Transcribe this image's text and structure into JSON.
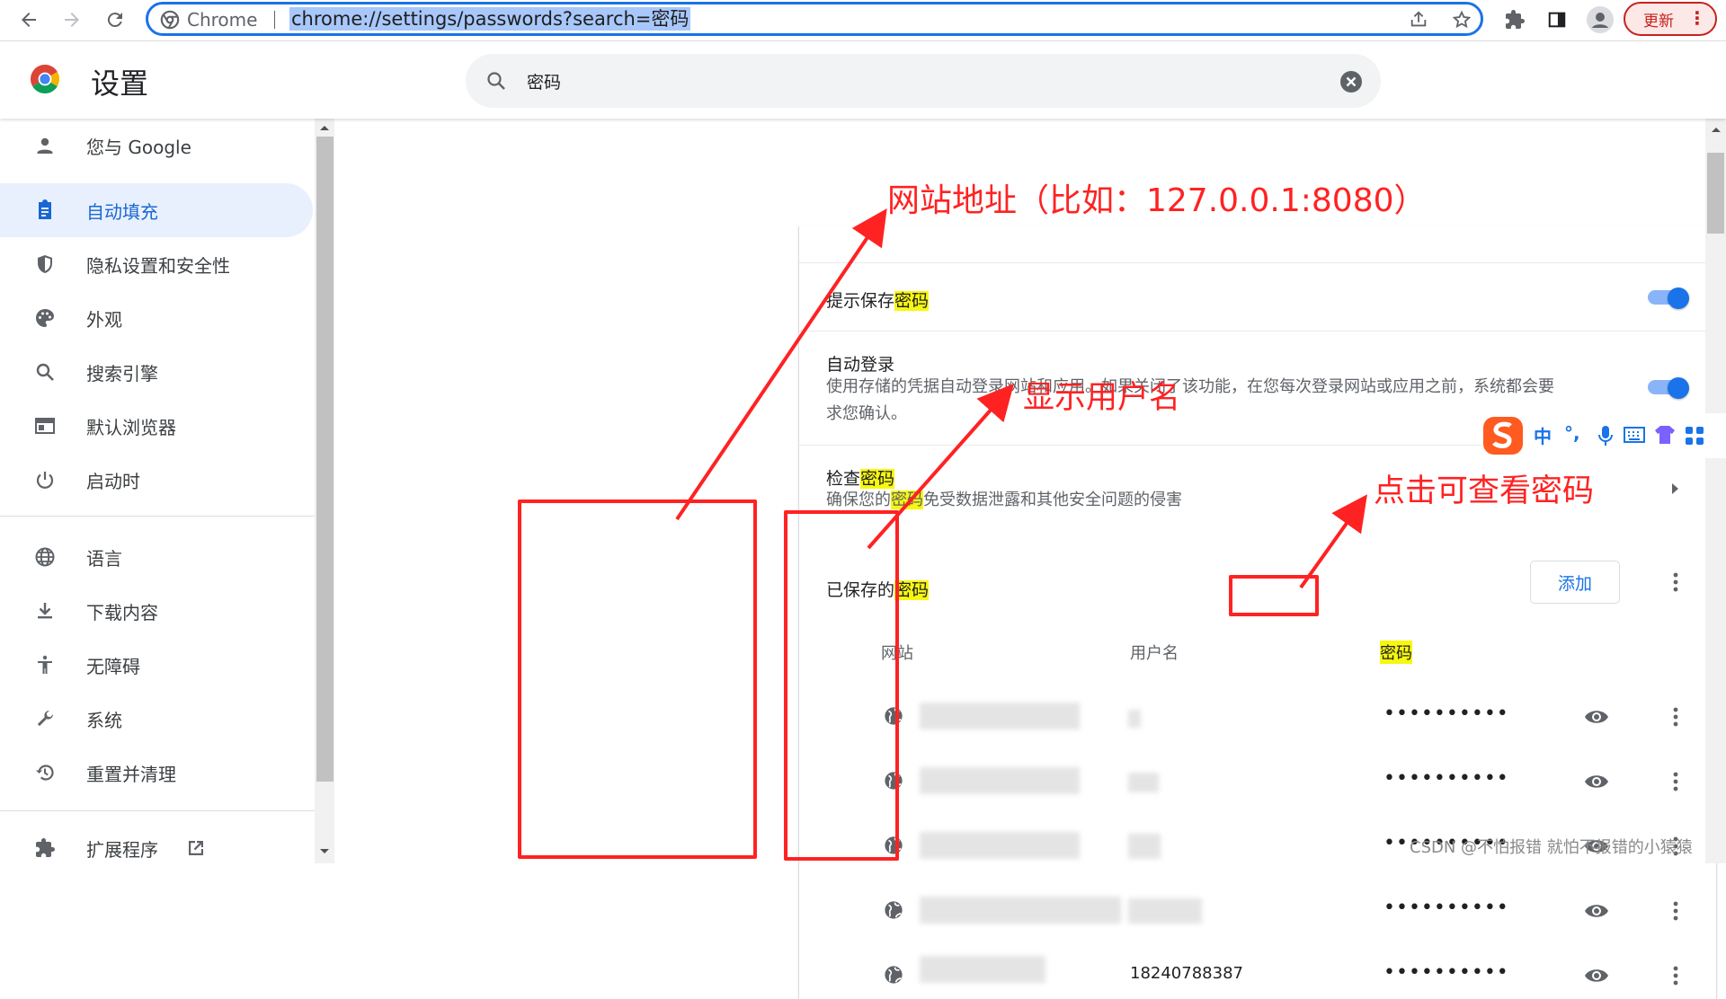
{
  "browser": {
    "site_label": "Chrome",
    "url": "chrome://settings/passwords?search=密码",
    "update_label": "更新"
  },
  "header": {
    "title": "设置",
    "search_value": "密码"
  },
  "sidebar": {
    "items": [
      {
        "label": "您与 Google",
        "icon": "person-icon"
      },
      {
        "label": "自动填充",
        "icon": "assignment-icon",
        "active": true
      },
      {
        "label": "隐私设置和安全性",
        "icon": "shield-icon"
      },
      {
        "label": "外观",
        "icon": "palette-icon"
      },
      {
        "label": "搜索引擎",
        "icon": "search-icon"
      },
      {
        "label": "默认浏览器",
        "icon": "browser-icon"
      },
      {
        "label": "启动时",
        "icon": "power-icon"
      },
      {
        "label": "语言",
        "icon": "globe-icon"
      },
      {
        "label": "下载内容",
        "icon": "download-icon"
      },
      {
        "label": "无障碍",
        "icon": "accessibility-icon"
      },
      {
        "label": "系统",
        "icon": "wrench-icon"
      },
      {
        "label": "重置并清理",
        "icon": "restore-icon"
      },
      {
        "label": "扩展程序",
        "icon": "puzzle-icon"
      }
    ]
  },
  "main": {
    "offer_save_pre": "提示保存",
    "offer_save_hl": "密码",
    "auto_signin_title": "自动登录",
    "auto_signin_desc_1": "使用存储的凭据自动登录网站和应用。如果关闭了该功能，在您每次登录网站或应用之前，系统都会要",
    "auto_signin_desc_2": "求您确认。",
    "check_pre": "检查",
    "check_hl": "密码",
    "check_desc_pre": "确保您的",
    "check_desc_hl": "密码",
    "check_desc_post": "免受数据泄露和其他安全问题的侵害",
    "saved_pre": "已保存的",
    "saved_hl": "密码",
    "add_label": "添加",
    "col_site": "网站",
    "col_user": "用户名",
    "col_pass": "密码",
    "rows": [
      {
        "password": "••••••••••"
      },
      {
        "password": "••••••••••"
      },
      {
        "password": "••••••••••"
      },
      {
        "password": "••••••••••"
      },
      {
        "password": "••••••••••",
        "username": "18240788387"
      }
    ]
  },
  "annotations": {
    "site_note": "网站地址（比如：127.0.0.1:8080）",
    "user_note": "显示用户名",
    "eye_note": "点击可查看密码"
  },
  "ime": {
    "items": [
      "中",
      "°,"
    ]
  },
  "watermark": "CSDN @不怕报错 就怕不报错的小猿猿",
  "colors": {
    "accent": "#1a73e8",
    "annotation": "#ff2222",
    "highlight": "#f7f70f"
  }
}
